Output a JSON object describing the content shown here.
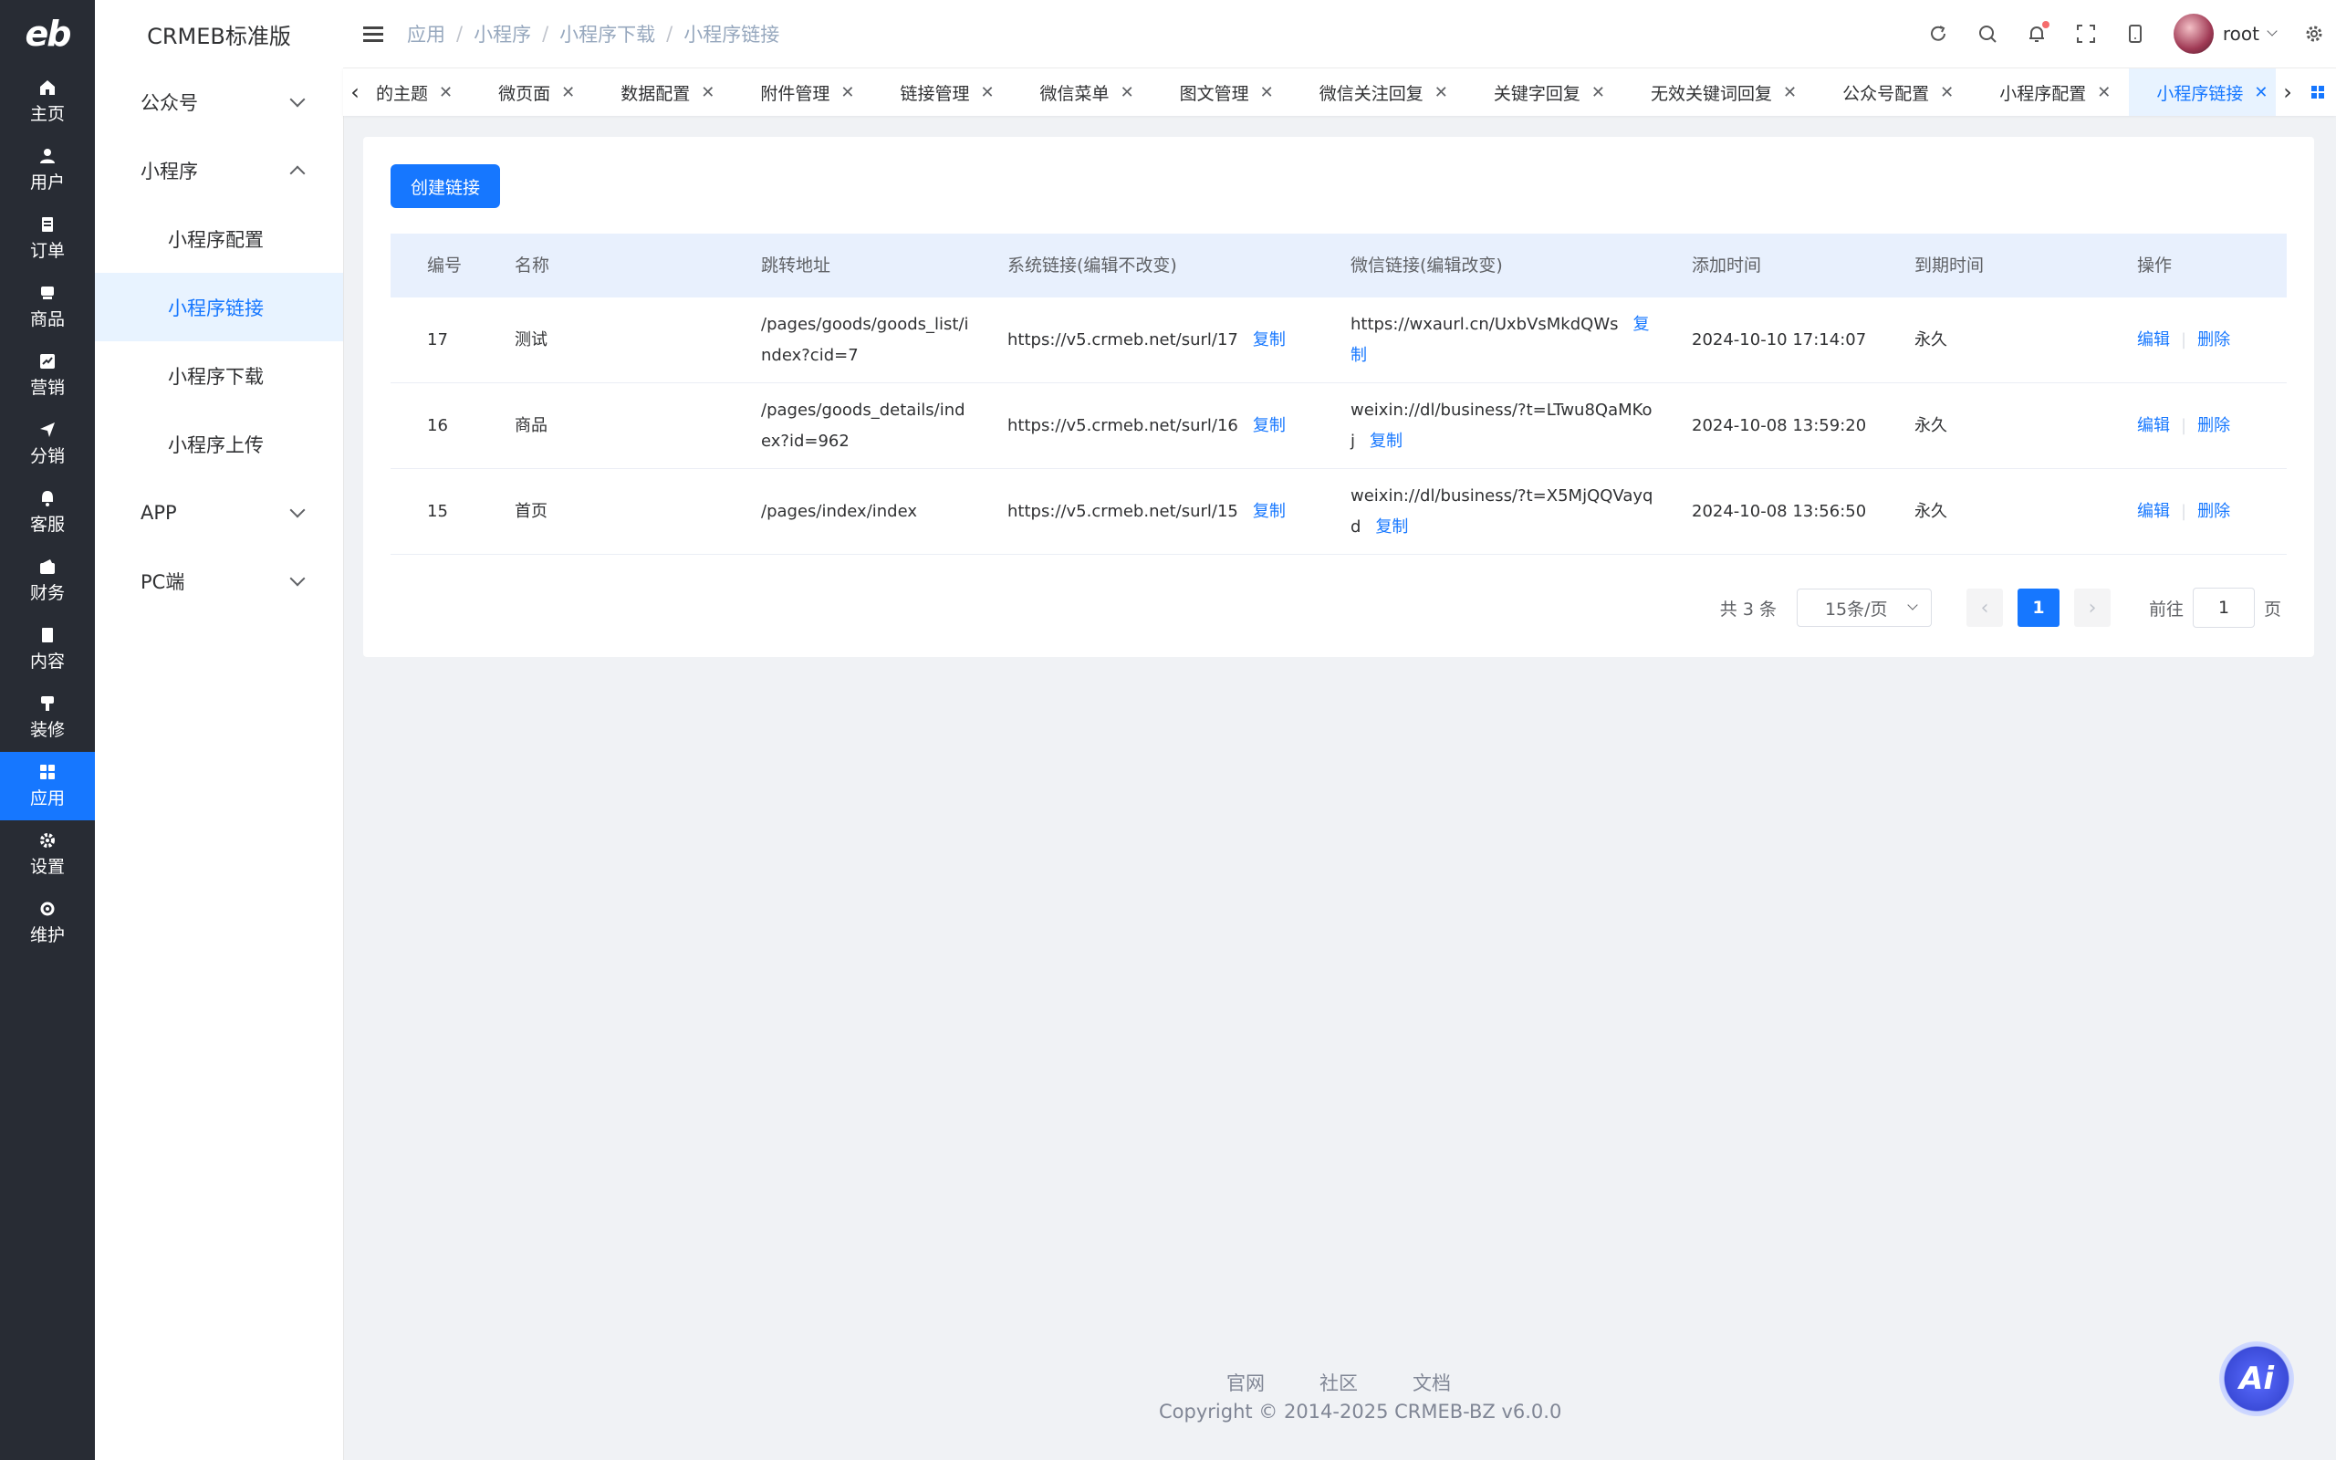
{
  "rail": {
    "logo": "eb",
    "items": [
      {
        "label": "主页",
        "icon": "home-icon"
      },
      {
        "label": "用户",
        "icon": "user-icon"
      },
      {
        "label": "订单",
        "icon": "order-icon"
      },
      {
        "label": "商品",
        "icon": "goods-icon"
      },
      {
        "label": "营销",
        "icon": "marketing-icon"
      },
      {
        "label": "分销",
        "icon": "distribution-icon"
      },
      {
        "label": "客服",
        "icon": "service-icon"
      },
      {
        "label": "财务",
        "icon": "finance-icon"
      },
      {
        "label": "内容",
        "icon": "content-icon"
      },
      {
        "label": "装修",
        "icon": "decorate-icon"
      },
      {
        "label": "应用",
        "icon": "apps-icon",
        "active": true
      },
      {
        "label": "设置",
        "icon": "settings-icon"
      },
      {
        "label": "维护",
        "icon": "maintenance-icon"
      }
    ]
  },
  "submenu": {
    "title": "CRMEB标准版",
    "groups": {
      "g1": "公众号",
      "g2": "小程序",
      "g3": "APP",
      "g4": "PC端"
    },
    "mini_items": [
      "小程序配置",
      "小程序链接",
      "小程序下载",
      "小程序上传"
    ]
  },
  "header": {
    "breadcrumb": [
      "应用",
      "小程序",
      "小程序下载",
      "小程序链接"
    ],
    "user": "root"
  },
  "tabs": [
    {
      "label": "的主题"
    },
    {
      "label": "微页面"
    },
    {
      "label": "数据配置"
    },
    {
      "label": "附件管理"
    },
    {
      "label": "链接管理"
    },
    {
      "label": "微信菜单"
    },
    {
      "label": "图文管理"
    },
    {
      "label": "微信关注回复"
    },
    {
      "label": "关键字回复"
    },
    {
      "label": "无效关键词回复"
    },
    {
      "label": "公众号配置"
    },
    {
      "label": "小程序配置"
    },
    {
      "label": "小程序链接",
      "active": true
    }
  ],
  "main": {
    "create_button": "创建链接",
    "columns": [
      "编号",
      "名称",
      "跳转地址",
      "系统链接(编辑不改变)",
      "微信链接(编辑改变)",
      "添加时间",
      "到期时间",
      "操作"
    ],
    "rows": [
      {
        "id": "17",
        "name": "测试",
        "path": "/pages/goods/goods_list/index?cid=7",
        "sys_link": "https://v5.crmeb.net/surl/17",
        "wx_link": "https://wxaurl.cn/UxbVsMkdQWs",
        "added": "2024-10-10 17:14:07",
        "expire": "永久"
      },
      {
        "id": "16",
        "name": "商品",
        "path": "/pages/goods_details/index?id=962",
        "sys_link": "https://v5.crmeb.net/surl/16",
        "wx_link": "weixin://dl/business/?t=LTwu8QaMKoj",
        "added": "2024-10-08 13:59:20",
        "expire": "永久"
      },
      {
        "id": "15",
        "name": "首页",
        "path": "/pages/index/index",
        "sys_link": "https://v5.crmeb.net/surl/15",
        "wx_link": "weixin://dl/business/?t=X5MjQQVayqd",
        "added": "2024-10-08 13:56:50",
        "expire": "永久"
      }
    ],
    "copy_label": "复制",
    "edit_label": "编辑",
    "delete_label": "删除"
  },
  "pagination": {
    "total": "共 3 条",
    "page_size": "15条/页",
    "current": "1",
    "goto_label": "前往",
    "goto_value": "1",
    "page_suffix": "页"
  },
  "footer": {
    "links": [
      "官网",
      "社区",
      "文档"
    ],
    "copyright": "Copyright © 2014-2025 CRMEB-BZ v6.0.0"
  },
  "ai_button": "Ai",
  "colors": {
    "primary": "#1677ff",
    "rail": "#282c34",
    "table_header": "#e8f0fd"
  }
}
